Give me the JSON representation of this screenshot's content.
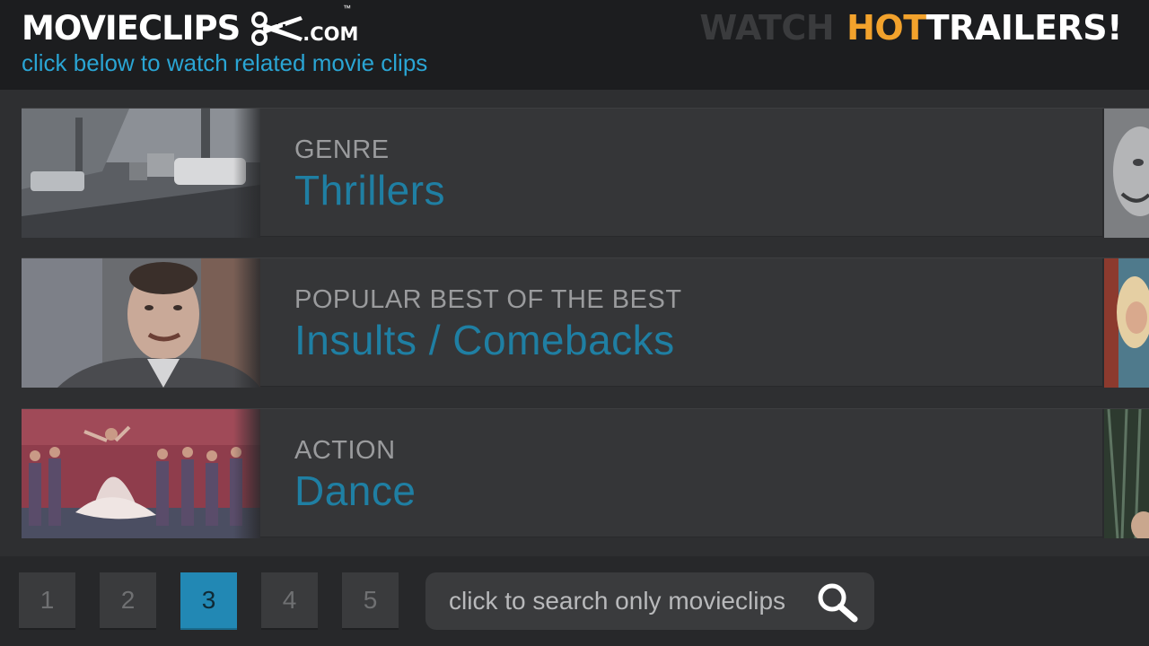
{
  "header": {
    "logo_text": "MOVIECLIPS",
    "logo_tm": "™",
    "logo_suffix": ".COM",
    "tagline": "click below to watch related movie clips",
    "promo_watch": "WATCH",
    "promo_hot": "HOT",
    "promo_trailers": "TRAILERS!",
    "colors": {
      "accent_blue": "#2aa5d4",
      "hot_orange": "#f2a22c"
    }
  },
  "rows": [
    {
      "category": "GENRE",
      "title": "Thrillers"
    },
    {
      "category": "POPULAR BEST OF THE BEST",
      "title": "Insults / Comebacks"
    },
    {
      "category": "ACTION",
      "title": "Dance"
    }
  ],
  "pagination": {
    "pages": [
      "1",
      "2",
      "3",
      "4",
      "5"
    ],
    "active": "3"
  },
  "search": {
    "placeholder": "click to search only movieclips",
    "icon": "search-icon"
  }
}
